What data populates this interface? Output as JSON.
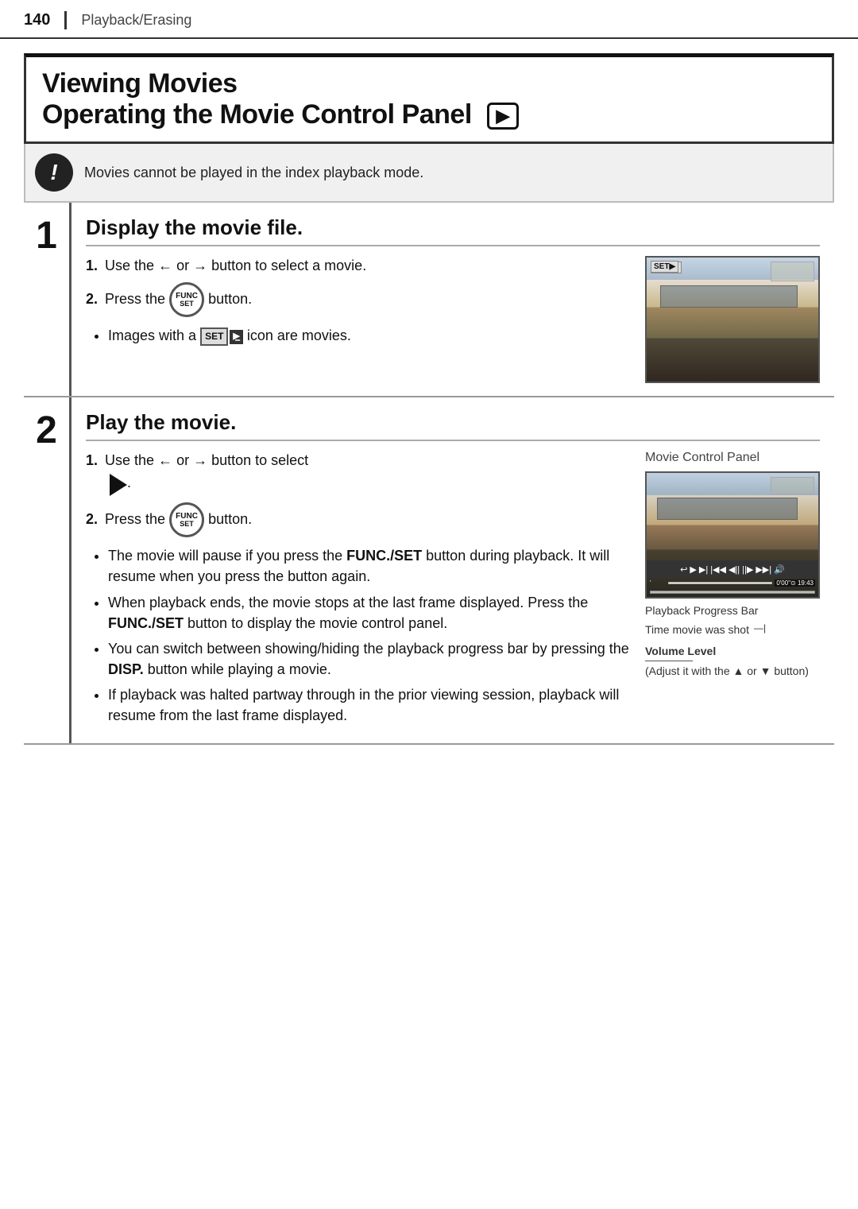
{
  "header": {
    "page_number": "140",
    "section": "Playback/Erasing"
  },
  "title": {
    "line1": "Viewing Movies",
    "line2": "Operating the Movie Control Panel",
    "playback_icon": "▶"
  },
  "warning": {
    "text": "Movies cannot be played in the index playback mode."
  },
  "step1": {
    "number": "1",
    "title": "Display the movie file.",
    "instruction1_prefix": "1.",
    "instruction1": "Use the ← or → button to select a movie.",
    "instruction2_prefix": "2.",
    "instruction2": "Press the",
    "instruction2_suffix": "button.",
    "bullet": "Images with a",
    "bullet_suffix": "icon are movies."
  },
  "step2": {
    "number": "2",
    "title": "Play the movie.",
    "instruction1_prefix": "1.",
    "instruction1": "Use the ← or → button to select",
    "instruction2_prefix": "2.",
    "instruction2": "Press the",
    "instruction2_suffix": "button.",
    "image_label": "Movie Control Panel",
    "label_progress": "Playback Progress Bar",
    "label_time": "Time movie was shot",
    "label_volume": "Volume Level",
    "label_volume_sub": "(Adjust it with the ▲ or ▼ button)",
    "bullet1": "The movie will pause if you press the FUNC./SET button during playback. It will resume when you press the button again.",
    "bullet2": "When playback ends, the movie stops at the last frame displayed. Press the FUNC./SET button to display the movie control panel.",
    "bullet3": "You can switch between showing/hiding the playback progress bar by pressing the DISP. button while playing a movie.",
    "bullet4": "If playback was halted partway through in the prior viewing session, playback will resume from the last frame displayed."
  }
}
